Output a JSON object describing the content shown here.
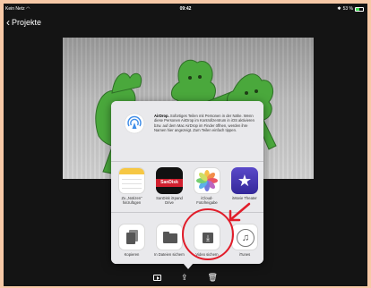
{
  "status_bar": {
    "carrier": "Kein Netz",
    "time": "09:42",
    "bluetooth": "✱",
    "battery_percent": "53 %",
    "battery_level": 0.53,
    "battery_color": "#3ddc54"
  },
  "nav": {
    "back_label": "Projekte",
    "back_icon": "chevron-left-icon"
  },
  "share_sheet": {
    "airdrop": {
      "title": "AirDrop.",
      "description": "Sofortiges Teilen mit Personen in der Nähe. Wenn diese Personen AirDrop im Kontrollzentrum in iOS aktivieren bzw. auf dem Mac AirDrop im Finder öffnen, werden ihre Namen hier angezeigt. Zum Teilen einfach tippen."
    },
    "apps": [
      {
        "label": "Zu „Notizen“ hinzufügen",
        "icon": "notes-icon"
      },
      {
        "label": "SanDisk iXpand Drive",
        "icon": "sandisk-icon",
        "badge": "SanDisk"
      },
      {
        "label": "iCloud-Fotofreigabe",
        "icon": "photos-icon"
      },
      {
        "label": "iMovie Theater",
        "icon": "imovie-icon"
      }
    ],
    "actions": [
      {
        "label": "Kopieren",
        "icon": "copy-icon"
      },
      {
        "label": "In Dateien sichern",
        "icon": "folder-icon"
      },
      {
        "label": "Video sichern",
        "icon": "save-video-icon"
      },
      {
        "label": "iTunes",
        "icon": "itunes-icon"
      }
    ]
  },
  "colors": {
    "annotation_red": "#e11d2a",
    "sheet_background": "#e9e9ec",
    "screen_background": "#141414",
    "outer_border": "#f7c9a7"
  }
}
